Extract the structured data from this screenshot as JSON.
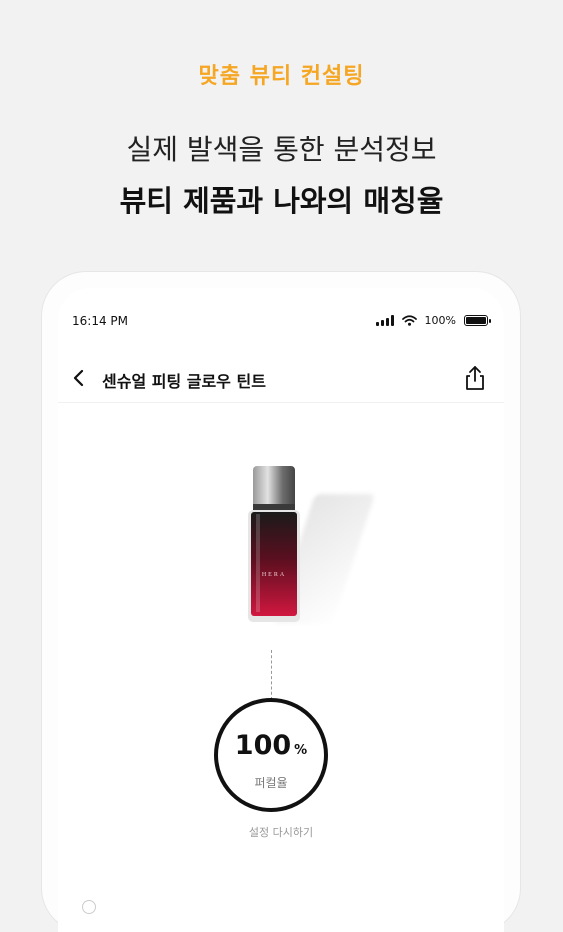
{
  "promo": {
    "kicker": "맞춤 뷰티 컨설팅",
    "line1": "실제 발색을 통한 분석정보",
    "line2": "뷰티 제품과 나와의 매칭율"
  },
  "status_bar": {
    "time": "16:14 PM",
    "battery_text": "100%",
    "battery_level": 1.0
  },
  "nav": {
    "title": "센슈얼 피팅 글로우 틴트",
    "back_icon": "chevron-left-icon",
    "share_icon": "share-icon"
  },
  "product": {
    "brand_text": "HERA",
    "cap_color": "#6e6e6e",
    "liquid_top_color": "#1a1a1a",
    "liquid_bottom_color": "#d1173f"
  },
  "match": {
    "value": "100",
    "unit": "%",
    "label": "퍼컬율"
  },
  "reset_label": "설정 다시하기",
  "colors": {
    "accent": "#f5a623",
    "background": "#f2f2f2"
  }
}
